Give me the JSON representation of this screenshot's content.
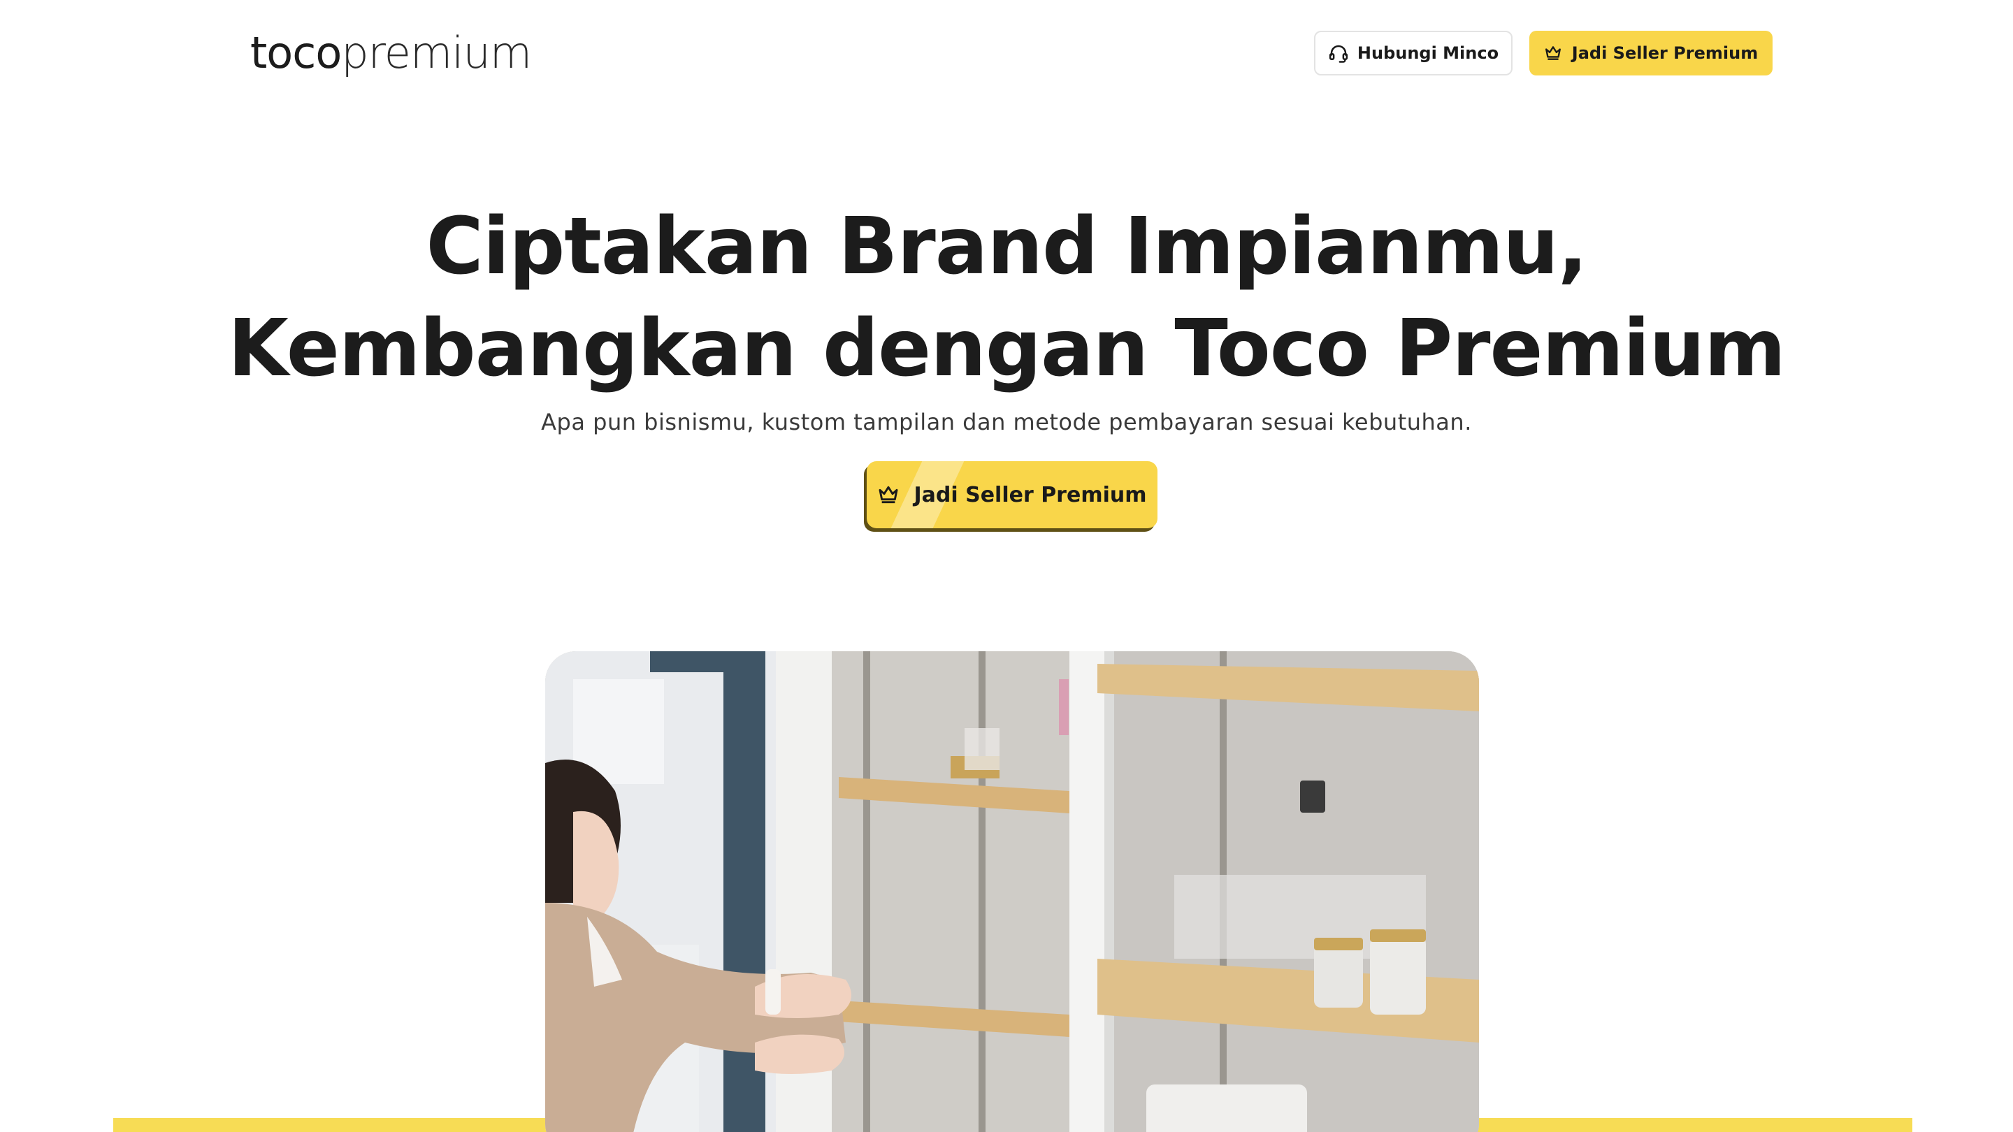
{
  "header": {
    "logo": {
      "part1": "toco",
      "part2": "premium"
    },
    "contact_button": {
      "label": "Hubungi Minco",
      "icon": "headset-icon"
    },
    "seller_button": {
      "label": "Jadi Seller Premium",
      "icon": "crown-icon"
    }
  },
  "hero": {
    "title_line1": "Ciptakan Brand Impianmu,",
    "title_line2": "Kembangkan dengan Toco Premium",
    "subtitle": "Apa pun bisnismu, kustom tampilan dan metode pembayaran sesuai kebutuhan.",
    "cta": {
      "label": "Jadi Seller Premium",
      "icon": "crown-icon"
    }
  },
  "colors": {
    "accent_yellow": "#f9d64a",
    "text_dark": "#1c1c1c",
    "band_yellow": "#f7dc55"
  }
}
